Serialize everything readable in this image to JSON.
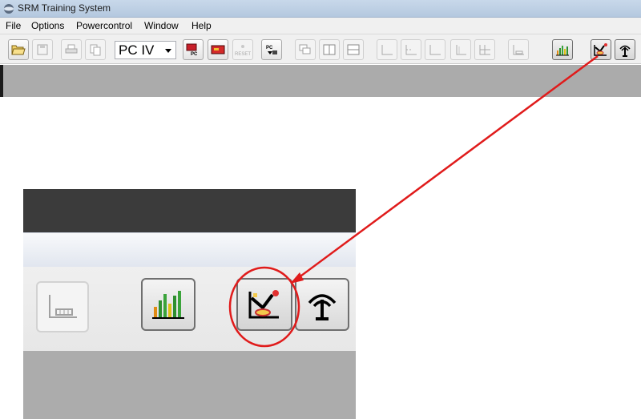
{
  "window": {
    "title": "SRM Training System"
  },
  "menu": {
    "items": [
      "File",
      "Options",
      "Powercontrol",
      "Window",
      "Help"
    ]
  },
  "toolbar": {
    "device_select": {
      "value": "PC IV"
    },
    "buttons": [
      {
        "icon": "open-folder-icon",
        "enabled": true
      },
      {
        "icon": "save-icon",
        "enabled": false
      },
      {
        "icon": "print-icon",
        "enabled": false
      },
      {
        "icon": "copy-icon",
        "enabled": false
      },
      {
        "icon": "pc-download-icon",
        "enabled": true
      },
      {
        "icon": "powercontrol-card-icon",
        "enabled": true
      },
      {
        "icon": "reset-icon",
        "enabled": false
      },
      {
        "icon": "pc-upload-icon",
        "enabled": true
      },
      {
        "icon": "cascade-windows-icon",
        "enabled": false
      },
      {
        "icon": "tile-vertical-icon",
        "enabled": false
      },
      {
        "icon": "tile-horizontal-icon",
        "enabled": false
      },
      {
        "icon": "chart-axes-icon",
        "enabled": false
      },
      {
        "icon": "chart-axes-dashed-icon",
        "enabled": false
      },
      {
        "icon": "chart-axes-2-icon",
        "enabled": false
      },
      {
        "icon": "chart-axes-3-icon",
        "enabled": false
      },
      {
        "icon": "chart-grid-icon",
        "enabled": false
      },
      {
        "icon": "chart-bars-small-icon",
        "enabled": false
      },
      {
        "icon": "bar-chart-icon",
        "enabled": true
      },
      {
        "icon": "ergometer-icon",
        "enabled": true
      },
      {
        "icon": "antenna-icon",
        "enabled": true
      }
    ],
    "reset_label": "RESET"
  },
  "colors": {
    "annotation": "#e01b1b",
    "workspace": "#ababab",
    "toolbar": "#f0f0f0"
  }
}
